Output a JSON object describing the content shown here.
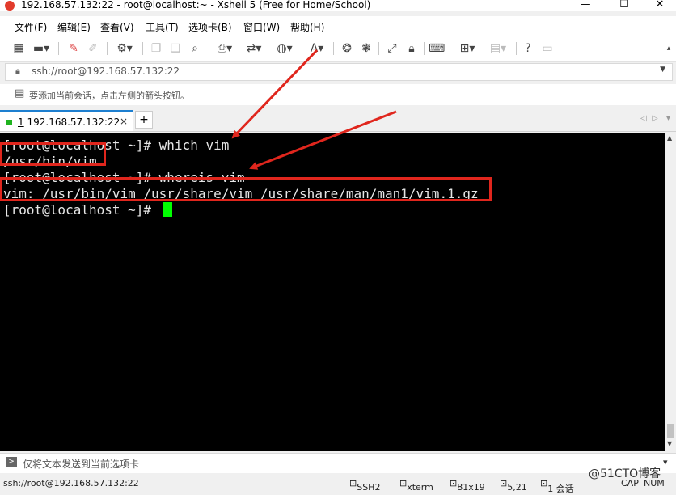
{
  "window": {
    "title": "192.168.57.132:22 - root@localhost:~ - Xshell 5 (Free for Home/School)",
    "minimize": "—",
    "maximize": "☐",
    "close": "✕"
  },
  "menu": [
    "文件(F)",
    "编辑(E)",
    "查看(V)",
    "工具(T)",
    "选项卡(B)",
    "窗口(W)",
    "帮助(H)"
  ],
  "toolbar": {
    "icons": [
      "new-session",
      "open-folder",
      "edit-pencil",
      "paint",
      "properties-gear",
      "copy",
      "paste",
      "find",
      "print",
      "transfer",
      "globe",
      "font",
      "xftp",
      "xmanager",
      "fullscreen",
      "lock",
      "keyboard",
      "add",
      "layout",
      "help",
      "chat"
    ]
  },
  "address": {
    "url": "ssh://root@192.168.57.132:22"
  },
  "hint": {
    "text": "要添加当前会话，点击左侧的箭头按钮。"
  },
  "tabs": [
    {
      "num": "1",
      "label": "192.168.57.132:22",
      "close": "×"
    }
  ],
  "add_tab": "+",
  "nav": {
    "left": "◁",
    "right": "▷",
    "menu": "▾"
  },
  "terminal": {
    "lines": [
      "[root@localhost ~]# which vim",
      "/usr/bin/vim",
      "[root@localhost ~]# whereis vim",
      "vim: /usr/bin/vim /usr/share/vim /usr/share/man/man1/vim.1.gz",
      "[root@localhost ~]# "
    ]
  },
  "sendbar": {
    "text": "仅将文本发送到当前选项卡"
  },
  "status": {
    "connection": "ssh://root@192.168.57.132:22",
    "protocol": "SSH2",
    "term": "xterm",
    "size": "81x19",
    "pos": "5,21",
    "sessions": "1 会话",
    "cap": "CAP",
    "num": "NUM"
  },
  "watermark": "@51CTO博客",
  "colors": {
    "annotation_red": "#e0261d",
    "cursor_green": "#00ff00",
    "tab_accent": "#1d7fd0"
  }
}
